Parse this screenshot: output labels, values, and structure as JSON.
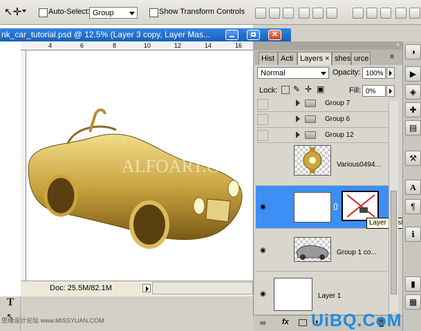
{
  "options_bar": {
    "auto_select_label": "Auto-Select:",
    "auto_select_value": "Group",
    "show_transform_label": "Show Transform Controls"
  },
  "document": {
    "title": "nk_car_tutorial.psd @ 12.5% (Layer 3 copy, Layer Mas...",
    "ruler_ticks": [
      "4",
      "6",
      "8",
      "10",
      "12",
      "14",
      "16"
    ],
    "status": "Doc: 25.5M/82.1M",
    "watermark": "ALFOART.COM"
  },
  "panel": {
    "tabs": [
      "Hist",
      "Acti",
      "Layers",
      "shes",
      "urce"
    ],
    "blend_mode": "Normal",
    "opacity_label": "Opacity:",
    "opacity_value": "100%",
    "lock_label": "Lock:",
    "fill_label": "Fill:",
    "fill_value": "0%",
    "layers": [
      {
        "name": "Group 7"
      },
      {
        "name": "Group 6"
      },
      {
        "name": "Group 12"
      },
      {
        "name": "Various0494..."
      },
      {
        "name": ""
      },
      {
        "name": "Group 1 co..."
      },
      {
        "name": "Layer 1"
      }
    ],
    "tooltip": "Layer mask thu"
  },
  "footer": {
    "left_text": "思缘设计论坛 www.MISSYUAN.COM",
    "logo_text": "UiBQ.CoM"
  }
}
